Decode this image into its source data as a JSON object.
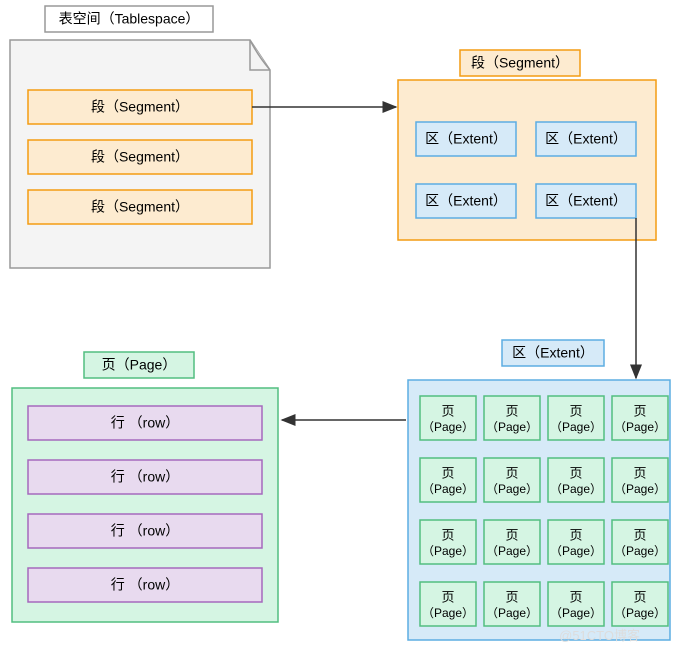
{
  "tablespace": {
    "title": "表空间（Tablespace）",
    "items": [
      "段（Segment）",
      "段（Segment）",
      "段（Segment）"
    ]
  },
  "segment": {
    "title": "段（Segment）",
    "items": [
      "区（Extent）",
      "区（Extent）",
      "区（Extent）",
      "区（Extent）"
    ]
  },
  "extent": {
    "title": "区（Extent）",
    "page_top": "页",
    "page_bottom": "（Page）"
  },
  "page": {
    "title": "页（Page）",
    "items": [
      "行 （row）",
      "行 （row）",
      "行 （row）",
      "行 （row）"
    ]
  },
  "colors": {
    "orange_fill": "#fdebd0",
    "orange_stroke": "#f39c12",
    "blue_fill": "#d6eaf8",
    "blue_stroke": "#5dade2",
    "green_fill": "#d5f5e3",
    "green_stroke": "#52be80",
    "purple_fill": "#e8daef",
    "purple_stroke": "#a569bd",
    "grey_fill": "#f4f4f4",
    "grey_stroke": "#999",
    "white": "#ffffff"
  },
  "watermark": "@51CTO博客"
}
